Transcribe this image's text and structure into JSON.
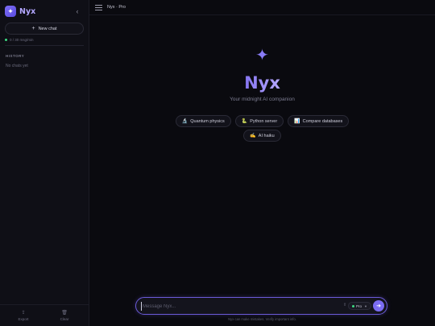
{
  "sidebar": {
    "brand": {
      "logo_icon": "✦",
      "name": "Nyx"
    },
    "collapse_icon": "‹",
    "new_chat": {
      "icon": "+",
      "label": "New chat"
    },
    "usage": {
      "text": "0 / 30 msg/min",
      "status_color": "#3ddc84"
    },
    "history": {
      "title": "HISTORY",
      "empty_text": "No chats yet"
    },
    "footer": {
      "export": {
        "icon": "⇪",
        "label": "Export"
      },
      "clear": {
        "icon": "🗑",
        "label": "Clear"
      }
    }
  },
  "topbar": {
    "title": "Nyx · Pro"
  },
  "hero": {
    "icon": "✦",
    "title": "Nyx",
    "subtitle": "Your midnight AI companion"
  },
  "suggestions": [
    {
      "icon": "🔬",
      "label": "Quantum physics"
    },
    {
      "icon": "🐍",
      "label": "Python server"
    },
    {
      "icon": "📊",
      "label": "Compare databases"
    },
    {
      "icon": "✍",
      "label": "AI haiku"
    }
  ],
  "composer": {
    "placeholder": "Message Nyx...",
    "mic_icon": "⇧",
    "model": "Pro",
    "send_icon": "➜"
  },
  "disclaimer": "Nyx can make mistakes. Verify important info.",
  "colors": {
    "accent": "#7b6cf2",
    "background": "#0a0a0f",
    "sidebar": "#0f0f16"
  }
}
